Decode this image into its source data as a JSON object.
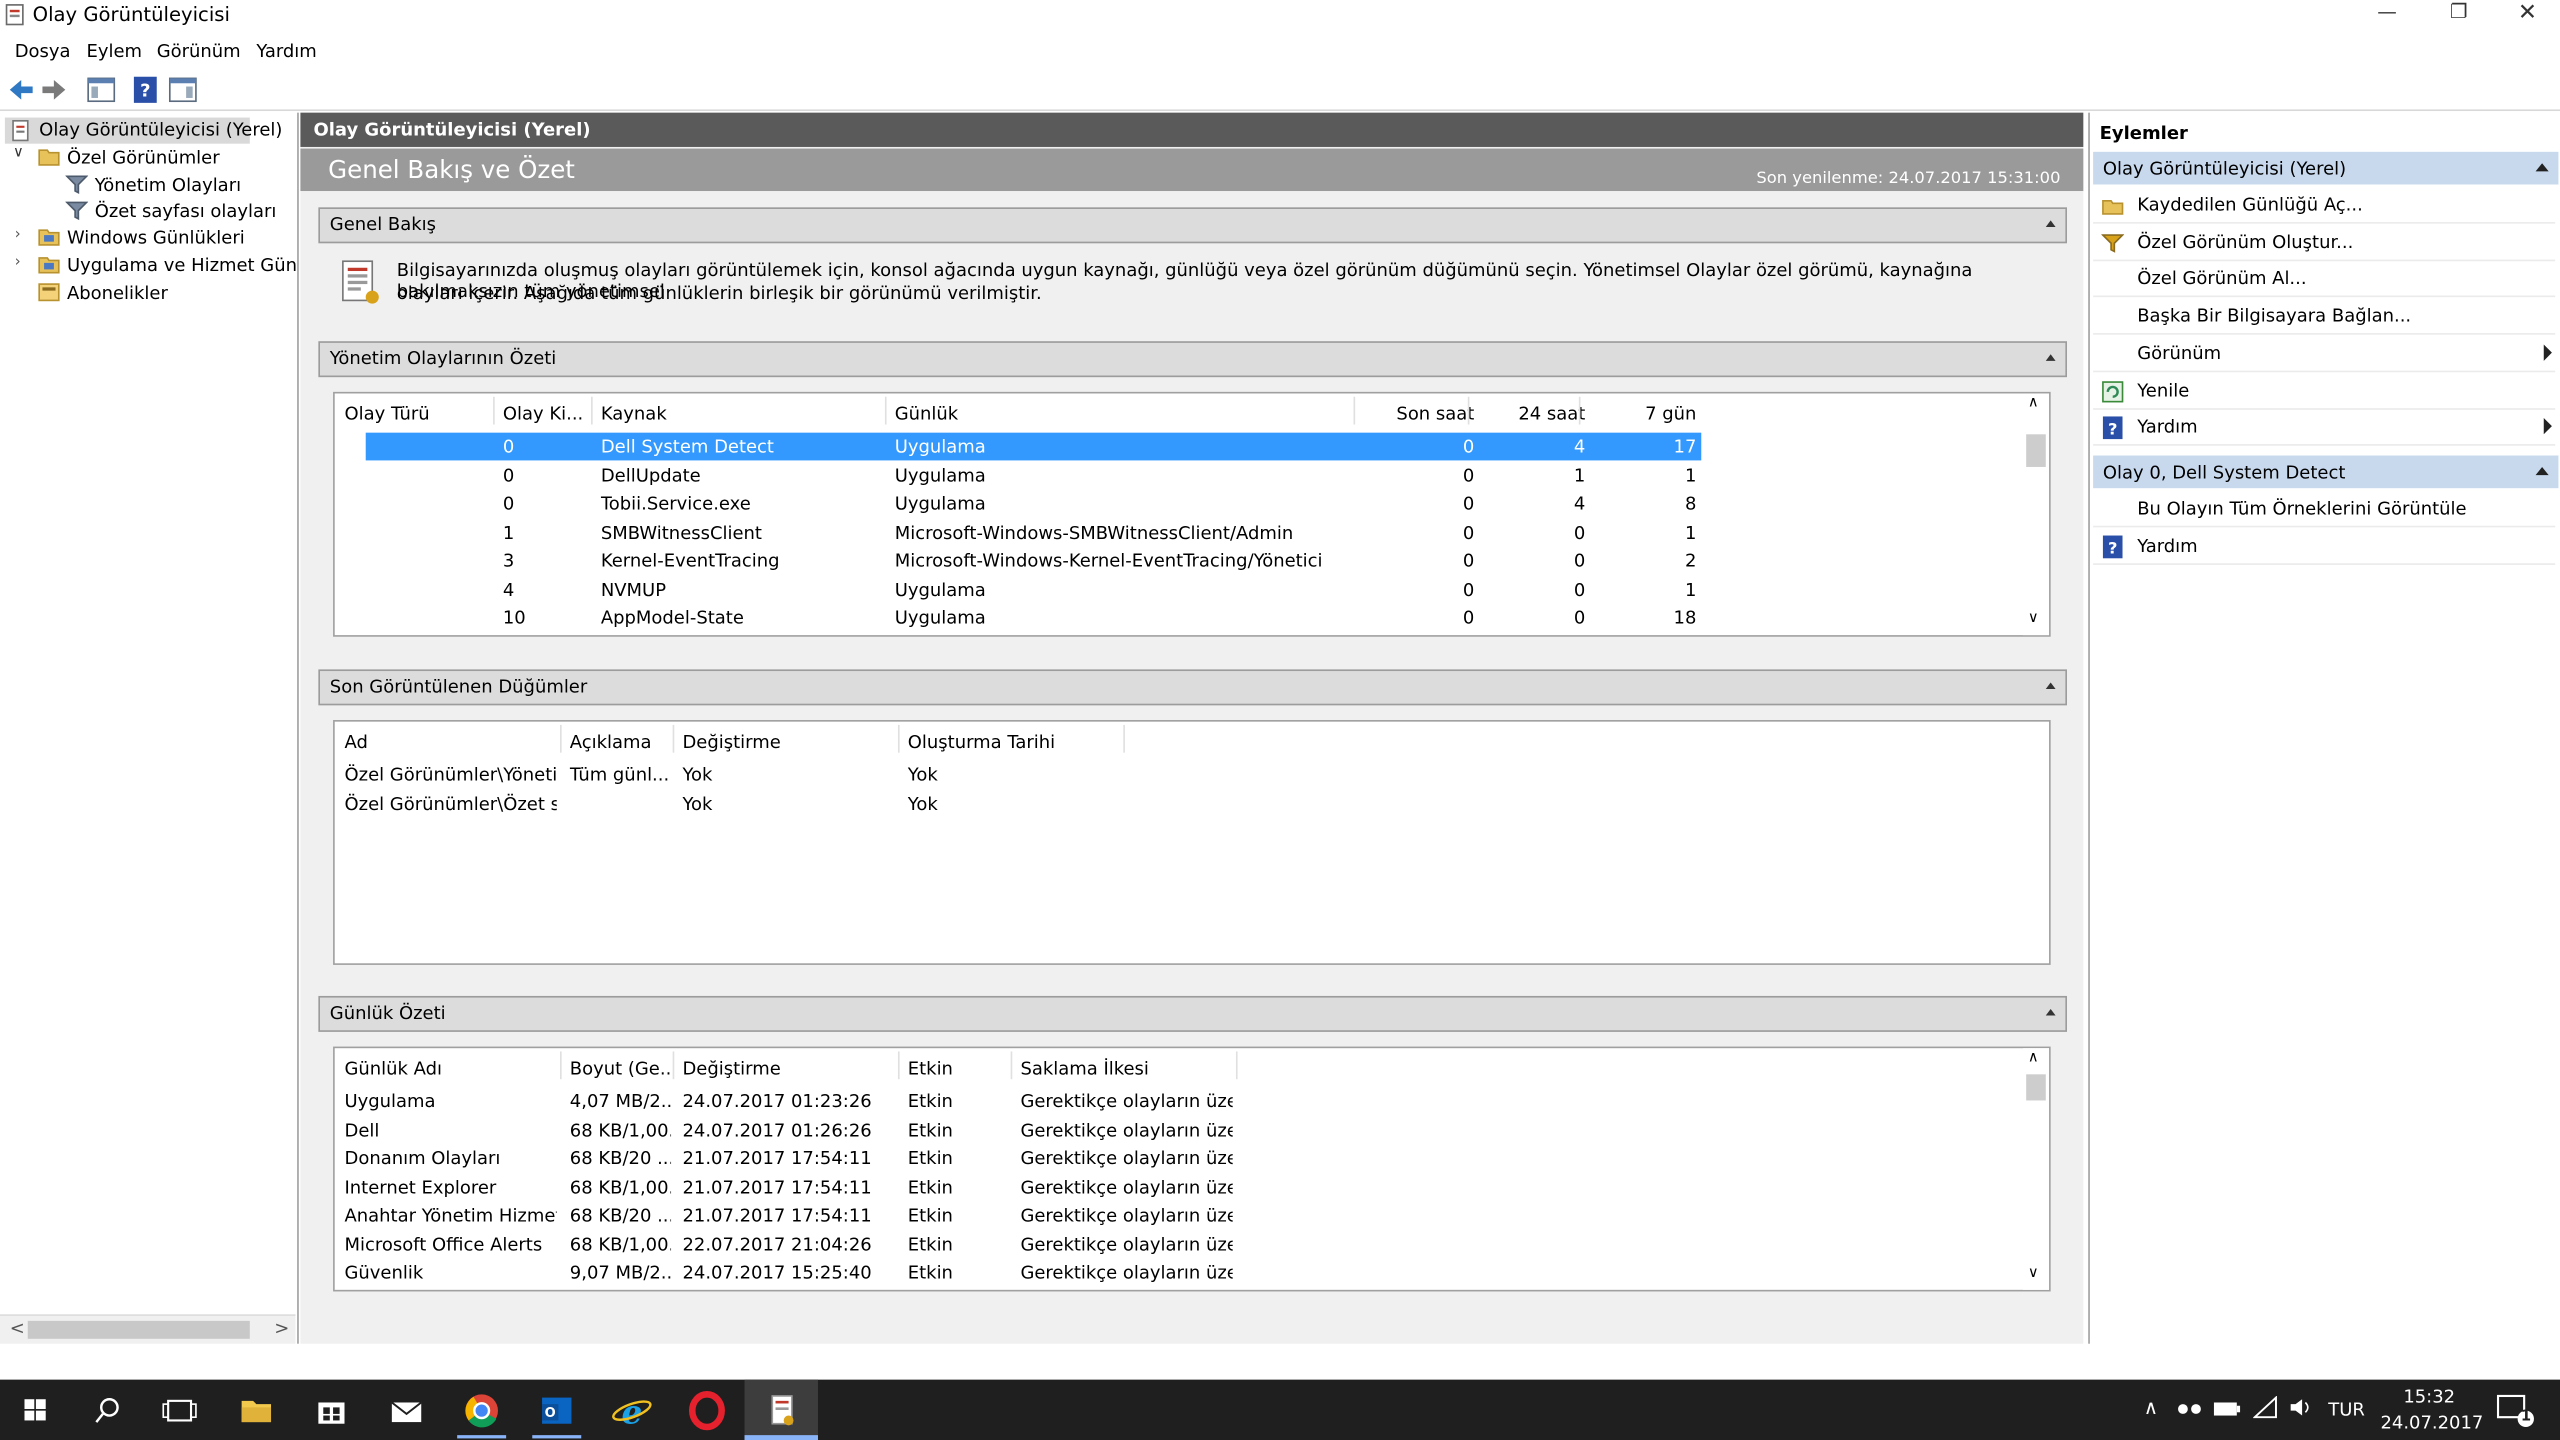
{
  "app": {
    "title": "Olay Görüntüleyicisi"
  },
  "menu": [
    "Dosya",
    "Eylem",
    "Görünüm",
    "Yardım"
  ],
  "tree": {
    "root": "Olay Görüntüleyicisi (Yerel)",
    "custom_views": "Özel Görünümler",
    "admin_events": "Yönetim Olayları",
    "summary_events": "Özet sayfası olayları",
    "windows_logs": "Windows Günlükleri",
    "app_service_logs": "Uygulama ve Hizmet Günlükl",
    "subscriptions": "Abonelikler"
  },
  "center": {
    "header": "Olay Görüntüleyicisi (Yerel)",
    "band_title": "Genel Bakış ve Özet",
    "last_refresh": "Son yenilenme: 24.07.2017 15:31:00",
    "overview": {
      "title": "Genel Bakış",
      "text_line1": "Bilgisayarınızda oluşmuş olayları görüntülemek için, konsol ağacında uygun kaynağı, günlüğü veya özel görünüm düğümünü seçin. Yönetimsel Olaylar özel görümü, kaynağına bakılmaksızın tüm yönetimsel",
      "text_line2": "olayları içerir. Aşağıda tüm günlüklerin birleşik bir görünümü verilmiştir."
    },
    "admin_summary": {
      "title": "Yönetim Olaylarının Özeti",
      "columns": [
        "Olay Türü",
        "Olay Ki...",
        "Kaynak",
        "Günlük",
        "Son saat",
        "24 saat",
        "7 gün"
      ],
      "rows": [
        {
          "type": "",
          "id": "0",
          "source": "Dell System Detect",
          "log": "Uygulama",
          "h": "0",
          "d": "4",
          "w": "17"
        },
        {
          "type": "",
          "id": "0",
          "source": "DellUpdate",
          "log": "Uygulama",
          "h": "0",
          "d": "1",
          "w": "1"
        },
        {
          "type": "",
          "id": "0",
          "source": "Tobii.Service.exe",
          "log": "Uygulama",
          "h": "0",
          "d": "4",
          "w": "8"
        },
        {
          "type": "",
          "id": "1",
          "source": "SMBWitnessClient",
          "log": "Microsoft-Windows-SMBWitnessClient/Admin",
          "h": "0",
          "d": "0",
          "w": "1"
        },
        {
          "type": "",
          "id": "3",
          "source": "Kernel-EventTracing",
          "log": "Microsoft-Windows-Kernel-EventTracing/Yönetici",
          "h": "0",
          "d": "0",
          "w": "2"
        },
        {
          "type": "",
          "id": "4",
          "source": "NVMUP",
          "log": "Uygulama",
          "h": "0",
          "d": "0",
          "w": "1"
        },
        {
          "type": "",
          "id": "10",
          "source": "AppModel-State",
          "log": "Uygulama",
          "h": "0",
          "d": "0",
          "w": "18"
        }
      ]
    },
    "recent_nodes": {
      "title": "Son Görüntülenen Düğümler",
      "columns": [
        "Ad",
        "Açıklama",
        "Değiştirme",
        "Oluşturma Tarihi"
      ],
      "rows": [
        {
          "name": "Özel Görünümler\\Yöneti...",
          "desc": "Tüm günl...",
          "mod": "Yok",
          "created": "Yok"
        },
        {
          "name": "Özel Görünümler\\Özet sa...",
          "desc": "",
          "mod": "Yok",
          "created": "Yok"
        }
      ]
    },
    "log_summary": {
      "title": "Günlük Özeti",
      "columns": [
        "Günlük Adı",
        "Boyut (Ge...",
        "Değiştirme",
        "Etkin",
        "Saklama İlkesi"
      ],
      "rows": [
        {
          "name": "Uygulama",
          "size": "4,07 MB/2...",
          "mod": "24.07.2017 01:23:26",
          "enabled": "Etkin",
          "policy": "Gerektikçe olayların üzeri..."
        },
        {
          "name": "Dell",
          "size": "68 KB/1,00...",
          "mod": "24.07.2017 01:26:26",
          "enabled": "Etkin",
          "policy": "Gerektikçe olayların üzeri..."
        },
        {
          "name": "Donanım Olayları",
          "size": "68 KB/20 ...",
          "mod": "21.07.2017 17:54:11",
          "enabled": "Etkin",
          "policy": "Gerektikçe olayların üzeri..."
        },
        {
          "name": "Internet Explorer",
          "size": "68 KB/1,00...",
          "mod": "21.07.2017 17:54:11",
          "enabled": "Etkin",
          "policy": "Gerektikçe olayların üzeri..."
        },
        {
          "name": "Anahtar Yönetim Hizmeti",
          "size": "68 KB/20 ...",
          "mod": "21.07.2017 17:54:11",
          "enabled": "Etkin",
          "policy": "Gerektikçe olayların üzeri..."
        },
        {
          "name": "Microsoft Office Alerts",
          "size": "68 KB/1,00...",
          "mod": "22.07.2017 21:04:26",
          "enabled": "Etkin",
          "policy": "Gerektikçe olayların üzeri..."
        },
        {
          "name": "Güvenlik",
          "size": "9,07 MB/2...",
          "mod": "24.07.2017 15:25:40",
          "enabled": "Etkin",
          "policy": "Gerektikçe olayların üzeri..."
        }
      ]
    }
  },
  "actions": {
    "title": "Eylemler",
    "group1_title": "Olay Görüntüleyicisi (Yerel)",
    "group1": [
      "Kaydedilen Günlüğü Aç...",
      "Özel Görünüm Oluştur...",
      "Özel Görünüm Al...",
      "Başka Bir Bilgisayara Bağlan...",
      "Görünüm",
      "Yenile",
      "Yardım"
    ],
    "group2_title": "Olay 0, Dell System Detect",
    "group2": [
      "Bu Olayın Tüm Örneklerini Görüntüle",
      "Yardım"
    ]
  },
  "taskbar": {
    "lang": "TUR",
    "time": "15:32",
    "date": "24.07.2017",
    "notification_count": "1"
  },
  "colors": {
    "selection": "#3399ff",
    "action_header": "#c8d9ee",
    "taskbar": "#1f1f1f"
  }
}
